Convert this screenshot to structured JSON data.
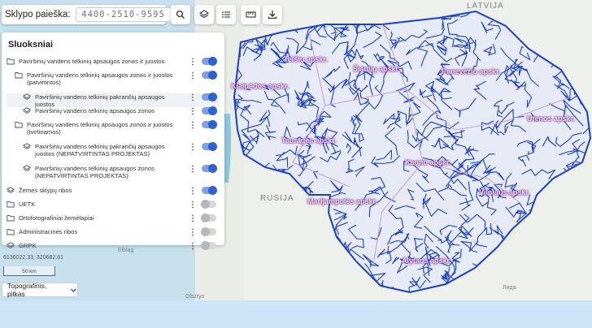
{
  "search": {
    "label": "Sklypo paieška:",
    "placeholder": "4400-2510-9595"
  },
  "toolbar": {
    "icons": [
      "search-icon",
      "layers-icon",
      "list-icon",
      "ruler-icon",
      "download-icon"
    ]
  },
  "panel": {
    "title": "Sluoksniai",
    "layers": [
      {
        "label": "Paviršinių vandens telkinių apsaugos zonos ir juostos",
        "icon": "folder-icon",
        "level": 0,
        "on": true
      },
      {
        "label": "Paviršinių vandens telkinių apsaugos zonos ir juostos (patvirtintos)",
        "icon": "folder-icon",
        "level": 1,
        "on": true
      },
      {
        "label": "Paviršinių vandens telkinių pakrančių apsaugos juostos",
        "icon": "layers-icon",
        "level": 2,
        "on": true
      },
      {
        "label": "Paviršinių vandens telkinių apsaugos zonos",
        "icon": "layers-icon",
        "level": 2,
        "on": true
      },
      {
        "label": "Paviršinių vandens telkinių apsaugos zonos ir juostos (tvirtinamos)",
        "icon": "folder-icon",
        "level": 1,
        "on": true
      },
      {
        "label": "Paviršinių vandens telkinių pakrančių apsaugos juostos (NEPATVIRTINTAS PROJEKTAS)",
        "icon": "layers-icon",
        "level": 2,
        "on": true
      },
      {
        "label": "Paviršinių vandens telkinių apsaugos zonos (NEPATVIRTINTAS PROJEKTAS)",
        "icon": "layers-icon",
        "level": 2,
        "on": true
      },
      {
        "label": "Žemės sklypų ribos",
        "icon": "layers-icon",
        "level": 0,
        "on": true
      },
      {
        "label": "UETK",
        "icon": "folder-icon",
        "level": 0,
        "on": false
      },
      {
        "label": "Ortofotografiniai žemėlapiai",
        "icon": "folder-icon",
        "level": 0,
        "on": false
      },
      {
        "label": "Administracinės ribos",
        "icon": "folder-icon",
        "level": 0,
        "on": false
      },
      {
        "label": "GRPK",
        "icon": "layers-icon",
        "level": 0,
        "on": false
      }
    ]
  },
  "map": {
    "coords": "6136022.33, 320682.81",
    "scale": "50 km",
    "basemap": "Topografinis, pilkas",
    "country_labels": [
      "LATVIJA",
      "RUSIJA"
    ],
    "city_labels": [
      "Elbląg",
      "Olsztyn",
      "Лида"
    ],
    "regions": [
      "Telšių apskr.",
      "Šiaulių apskr.",
      "Panevėžio apskr.",
      "Klaipėdos apskr.",
      "Utenos apskr.",
      "Tauragės apskr.",
      "Kauno apskr.",
      "Marijampolės apskr.",
      "Vilniaus apskr.",
      "Alytaus apskr."
    ],
    "colors": {
      "rivers": "#1a3fd1",
      "region_label": "#6b2a82",
      "toggle_on": "#2f61d1"
    }
  }
}
